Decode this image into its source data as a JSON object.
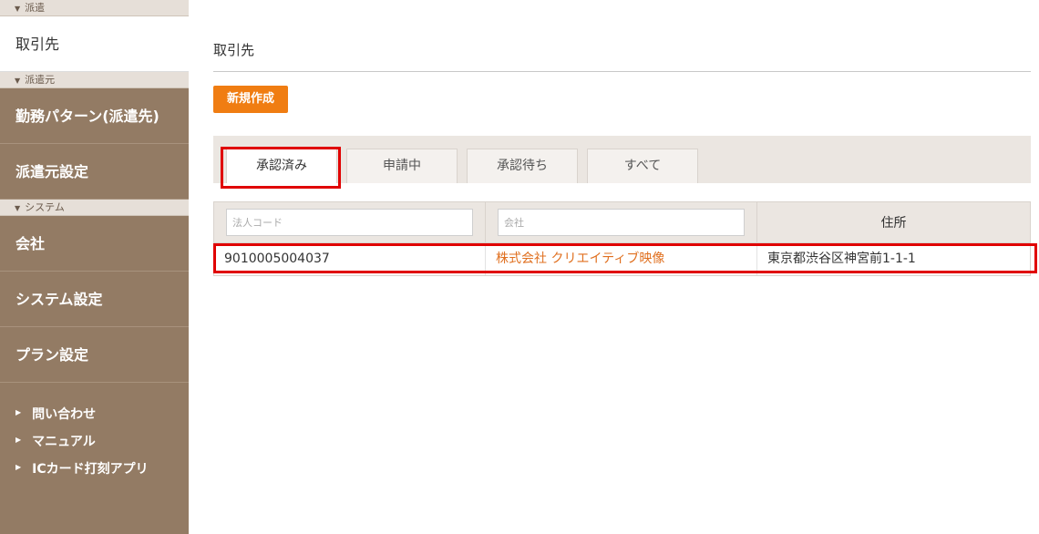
{
  "sidebar": {
    "section_dispatch": "派遣",
    "item_partners": "取引先",
    "section_source": "派遣元",
    "item_work_pattern": "勤務パターン(派遣先)",
    "item_source_settings": "派遣元設定",
    "section_system": "システム",
    "item_company": "会社",
    "item_system_settings": "システム設定",
    "item_plan_settings": "プラン設定",
    "link_contact": "問い合わせ",
    "link_manual": "マニュアル",
    "link_ic_app": "ICカード打刻アプリ"
  },
  "main": {
    "title": "取引先",
    "new_button": "新規作成",
    "tabs": [
      "承認済み",
      "申請中",
      "承認待ち",
      "すべて"
    ],
    "active_tab": "承認済み"
  },
  "table": {
    "filter_corp_code_placeholder": "法人コード",
    "filter_company_placeholder": "会社",
    "address_header": "住所",
    "rows": [
      {
        "corp_code": "9010005004037",
        "company": "株式会社 クリエイティブ映像",
        "address": "東京都渋谷区神宮前1-1-1"
      }
    ]
  },
  "colors": {
    "sidebar_bg": "#937b64",
    "accent_orange": "#f07d12",
    "link_orange": "#e07020",
    "highlight_red": "#e00000"
  }
}
